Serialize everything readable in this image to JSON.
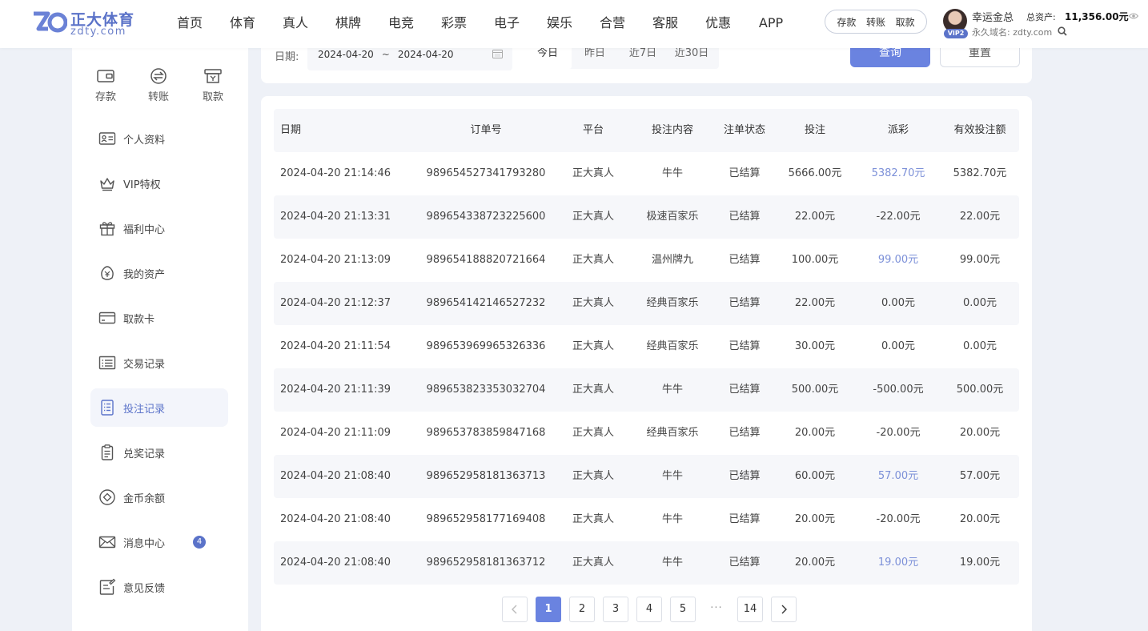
{
  "header": {
    "logo_cn": "正大体育",
    "logo_en": "zdty.com",
    "nav": [
      "首页",
      "体育",
      "真人",
      "棋牌",
      "电竞",
      "彩票",
      "电子",
      "娱乐",
      "合营",
      "客服",
      "优惠",
      "APP"
    ],
    "quick_actions": [
      "存款",
      "转账",
      "取款"
    ],
    "user": {
      "name": "幸运金总",
      "vip": "VIP2",
      "asset_label": "总资产:",
      "asset_value": "11,356.00元",
      "domain": "永久域名: zdty.com"
    }
  },
  "sidebar": {
    "quick": [
      {
        "label": "存款",
        "icon": "wallet-icon"
      },
      {
        "label": "转账",
        "icon": "transfer-icon"
      },
      {
        "label": "取款",
        "icon": "withdraw-icon"
      }
    ],
    "items": [
      {
        "label": "个人资料",
        "icon": "profile-card-icon"
      },
      {
        "label": "VIP特权",
        "icon": "crown-icon"
      },
      {
        "label": "福利中心",
        "icon": "gift-icon"
      },
      {
        "label": "我的资产",
        "icon": "asset-icon"
      },
      {
        "label": "取款卡",
        "icon": "bank-card-icon"
      },
      {
        "label": "交易记录",
        "icon": "transaction-list-icon"
      },
      {
        "label": "投注记录",
        "icon": "bet-record-icon"
      },
      {
        "label": "兑奖记录",
        "icon": "clipboard-icon"
      },
      {
        "label": "金币余额",
        "icon": "coin-icon"
      },
      {
        "label": "消息中心",
        "icon": "mail-icon"
      },
      {
        "label": "意见反馈",
        "icon": "feedback-icon"
      }
    ],
    "active_index": 6,
    "message_count": "4"
  },
  "filter": {
    "date_label": "日期:",
    "start_date": "2024-04-20",
    "separator": "~",
    "end_date": "2024-04-20",
    "quick_dates": [
      "今日",
      "昨日",
      "近7日",
      "近30日"
    ],
    "active_quick": 0,
    "query_label": "查询",
    "reset_label": "重置"
  },
  "table": {
    "headers": [
      "日期",
      "订单号",
      "平台",
      "投注内容",
      "注单状态",
      "投注",
      "派彩",
      "有效投注额"
    ],
    "rows": [
      [
        "2024-04-20 21:14:46",
        "989654527341793280",
        "正大真人",
        "牛牛",
        "已结算",
        "5666.00元",
        "5382.70元",
        "5382.70元"
      ],
      [
        "2024-04-20 21:13:31",
        "989654338723225600",
        "正大真人",
        "极速百家乐",
        "已结算",
        "22.00元",
        "-22.00元",
        "22.00元"
      ],
      [
        "2024-04-20 21:13:09",
        "989654188820721664",
        "正大真人",
        "温州牌九",
        "已结算",
        "100.00元",
        "99.00元",
        "99.00元"
      ],
      [
        "2024-04-20 21:12:37",
        "989654142146527232",
        "正大真人",
        "经典百家乐",
        "已结算",
        "22.00元",
        "0.00元",
        "0.00元"
      ],
      [
        "2024-04-20 21:11:54",
        "989653969965326336",
        "正大真人",
        "经典百家乐",
        "已结算",
        "30.00元",
        "0.00元",
        "0.00元"
      ],
      [
        "2024-04-20 21:11:39",
        "989653823353032704",
        "正大真人",
        "牛牛",
        "已结算",
        "500.00元",
        "-500.00元",
        "500.00元"
      ],
      [
        "2024-04-20 21:11:09",
        "989653783859847168",
        "正大真人",
        "经典百家乐",
        "已结算",
        "20.00元",
        "-20.00元",
        "20.00元"
      ],
      [
        "2024-04-20 21:08:40",
        "989652958181363713",
        "正大真人",
        "牛牛",
        "已结算",
        "60.00元",
        "57.00元",
        "57.00元"
      ],
      [
        "2024-04-20 21:08:40",
        "989652958177169408",
        "正大真人",
        "牛牛",
        "已结算",
        "20.00元",
        "-20.00元",
        "20.00元"
      ],
      [
        "2024-04-20 21:08:40",
        "989652958181363712",
        "正大真人",
        "牛牛",
        "已结算",
        "20.00元",
        "19.00元",
        "19.00元"
      ]
    ]
  },
  "pagination": {
    "pages": [
      "1",
      "2",
      "3",
      "4",
      "5"
    ],
    "ellipsis": "···",
    "last": "14",
    "current": "1"
  },
  "colors": {
    "accent": "#6a83e0",
    "positive_win": "#7c90d8"
  }
}
